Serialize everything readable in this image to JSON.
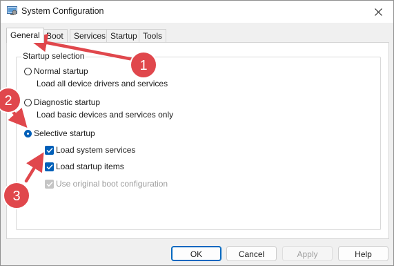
{
  "window": {
    "title": "System Configuration"
  },
  "tabs": [
    {
      "label": "General",
      "active": true
    },
    {
      "label": "Boot"
    },
    {
      "label": "Services"
    },
    {
      "label": "Startup"
    },
    {
      "label": "Tools"
    }
  ],
  "startup_selection": {
    "label": "Startup selection",
    "normal": {
      "label": "Normal startup",
      "desc": "Load all device drivers and services",
      "checked": false
    },
    "diagnostic": {
      "label": "Diagnostic startup",
      "desc": "Load basic devices and services only",
      "checked": false
    },
    "selective": {
      "label": "Selective startup",
      "checked": true,
      "options": {
        "system_services": {
          "label": "Load system services",
          "checked": true
        },
        "startup_items": {
          "label": "Load startup items",
          "checked": true
        },
        "original_boot": {
          "label": "Use original boot configuration",
          "checked": true,
          "disabled": true
        }
      }
    }
  },
  "buttons": {
    "ok": "OK",
    "cancel": "Cancel",
    "apply": "Apply",
    "help": "Help"
  },
  "annotations": {
    "badge1": "1",
    "badge2": "2",
    "badge3": "3"
  },
  "colors": {
    "accent": "#005fb8",
    "annotation": "#e0474c"
  }
}
